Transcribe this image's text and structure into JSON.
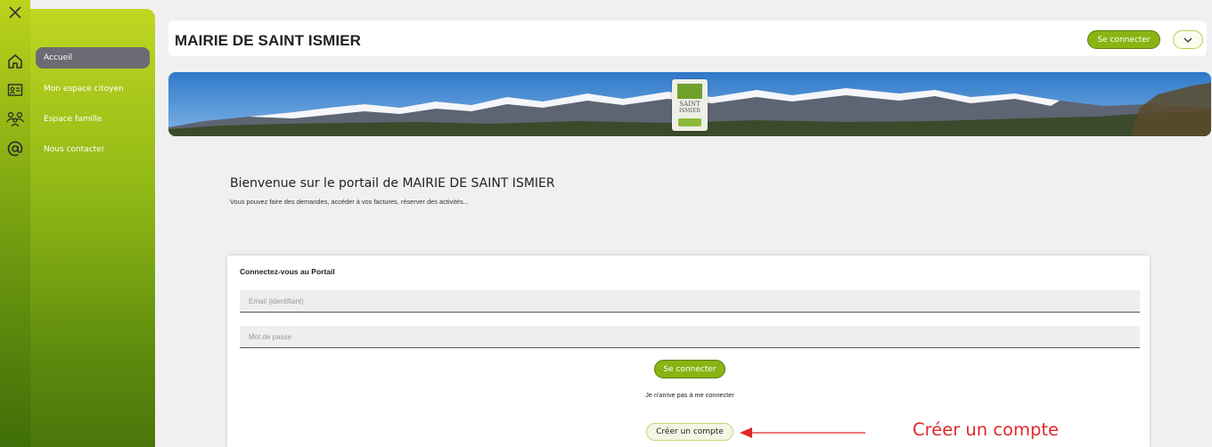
{
  "header": {
    "title": "MAIRIE DE SAINT ISMIER",
    "login_label": "Se connecter"
  },
  "sidebar": {
    "items": [
      {
        "label": "Accueil",
        "icon": "home-icon",
        "active": true
      },
      {
        "label": "Mon espace citoyen",
        "icon": "id-card-icon",
        "active": false
      },
      {
        "label": "Espace famille",
        "icon": "family-icon",
        "active": false
      },
      {
        "label": "Nous contacter",
        "icon": "at-sign-icon",
        "active": false
      }
    ]
  },
  "banner": {
    "logo_line1": "SAINT",
    "logo_line2": "ISMIER"
  },
  "welcome": {
    "title": "Bienvenue sur le portail de MAIRIE DE SAINT ISMIER",
    "subtitle": "Vous pouvez faire des demandes, accéder à vos factures, réserver des activités..."
  },
  "login_card": {
    "title": "Connectez-vous au Portail",
    "email_placeholder": "Email (identifiant)",
    "password_placeholder": "Mot de passe",
    "login_label": "Se connecter",
    "forgot_label": "Je n'arrive pas à me connecter",
    "create_account_label": "Créer un compte"
  },
  "annotation": {
    "text": "Créer un compte",
    "color": "#e0282a"
  },
  "colors": {
    "accent": "#89b413",
    "sidebar_active": "#6e6a73"
  }
}
